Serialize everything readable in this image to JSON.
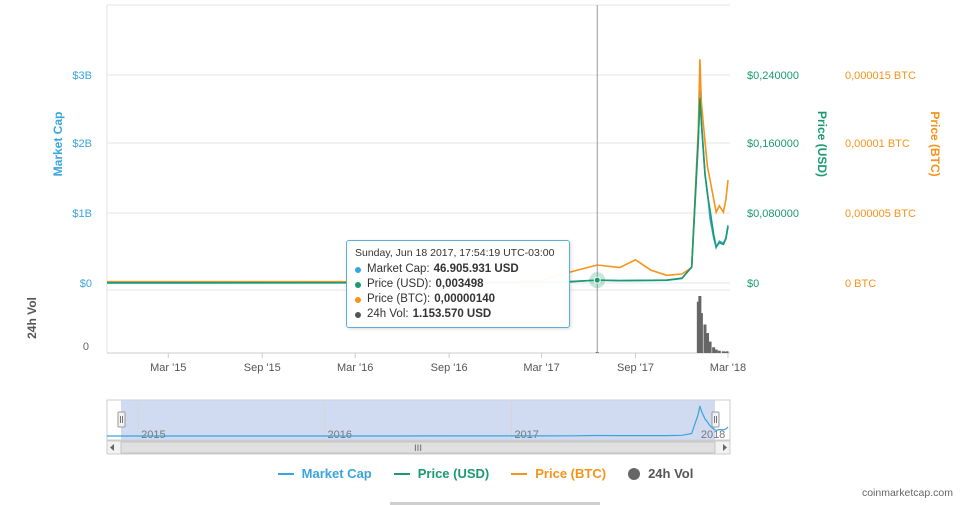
{
  "chart_data": {
    "type": "line",
    "y_axes": {
      "market_cap": {
        "title": "Market Cap",
        "ticks": [
          "$0",
          "$1B",
          "$2B",
          "$3B"
        ],
        "range": [
          0,
          3700000000
        ]
      },
      "price_usd": {
        "title": "Price (USD)",
        "ticks": [
          "$0",
          "$0,080000",
          "$0,160000",
          "$0,240000"
        ],
        "range": [
          0,
          0.296
        ]
      },
      "price_btc": {
        "title": "Price (BTC)",
        "ticks": [
          "0 BTC",
          "0,000005 BTC",
          "0,00001 BTC",
          "0,000015 BTC"
        ],
        "range": [
          0,
          1.85e-05
        ]
      },
      "volume": {
        "title": "24h Vol",
        "ticks": [
          "0"
        ]
      }
    },
    "x_ticks": [
      "Mar '15",
      "Sep '15",
      "Mar '16",
      "Sep '16",
      "Mar '17",
      "Sep '17",
      "Mar '18"
    ],
    "navigator_ticks": [
      "2015",
      "2016",
      "2017",
      "2018"
    ],
    "x": [
      "2014-11",
      "2015-03",
      "2015-09",
      "2016-03",
      "2016-09",
      "2017-01",
      "2017-03",
      "2017-05",
      "2017-06-18",
      "2017-08",
      "2017-09",
      "2017-10",
      "2017-11",
      "2017-12",
      "2017-12-20",
      "2018-01-02",
      "2018-01-05",
      "2018-01-08",
      "2018-01-15",
      "2018-01-20",
      "2018-01-25",
      "2018-02-01",
      "2018-02-06",
      "2018-02-12",
      "2018-02-20",
      "2018-02-25",
      "2018-03-01"
    ],
    "series": [
      {
        "name": "Market Cap",
        "color": "#3aa5dc",
        "axis": "market_cap",
        "values": [
          2000000,
          2000000,
          3000000,
          4000000,
          6000000,
          8000000,
          12000000,
          20000000,
          46905931,
          35000000,
          38000000,
          40000000,
          42000000,
          70000000,
          250000000,
          2200000000,
          3000000000,
          2500000000,
          1700000000,
          1400000000,
          1000000000,
          700000000,
          550000000,
          650000000,
          620000000,
          700000000,
          900000000
        ]
      },
      {
        "name": "Price (USD)",
        "color": "#1a9a70",
        "axis": "price_usd",
        "values": [
          0.0002,
          0.0002,
          0.0002,
          0.0003,
          0.0003,
          0.0004,
          0.0006,
          0.002,
          0.003498,
          0.003,
          0.0032,
          0.0034,
          0.0036,
          0.006,
          0.02,
          0.18,
          0.23,
          0.2,
          0.135,
          0.11,
          0.09,
          0.06,
          0.045,
          0.05,
          0.048,
          0.055,
          0.07
        ]
      },
      {
        "name": "Price (BTC)",
        "color": "#f7931a",
        "axis": "price_btc",
        "values": [
          1e-07,
          1e-07,
          1e-07,
          1e-07,
          1e-07,
          1e-07,
          2e-07,
          9e-07,
          1.4e-06,
          1.2e-06,
          1.8e-06,
          1e-06,
          6e-07,
          7e-07,
          1.2e-06,
          1.2e-05,
          1.74e-05,
          1.4e-05,
          1.1e-05,
          9e-06,
          8e-06,
          6.5e-06,
          5.5e-06,
          6e-06,
          5.5e-06,
          6.5e-06,
          8e-06
        ]
      },
      {
        "name": "24h Vol",
        "color": "#555555",
        "axis": "volume",
        "values": [
          0,
          0,
          0,
          0,
          0,
          0,
          0,
          0,
          1153570,
          0,
          0,
          0,
          0,
          0,
          0,
          90000000,
          100000000,
          70000000,
          50000000,
          35000000,
          20000000,
          10000000,
          6000000,
          4000000,
          3000000,
          2000000,
          3000000
        ]
      }
    ],
    "grid": true,
    "legend": "bottom"
  },
  "tooltip": {
    "date": "Sunday, Jun 18 2017, 17:54:19 UTC-03:00",
    "rows": [
      {
        "label": "Market Cap:",
        "value": "46.905.931 USD",
        "color": "#3aa5dc"
      },
      {
        "label": "Price (USD):",
        "value": "0,003498",
        "color": "#1a9a70"
      },
      {
        "label": "Price (BTC):",
        "value": "0,00000140",
        "color": "#f7931a"
      },
      {
        "label": "24h Vol:",
        "value": "1.153.570 USD",
        "color": "#555555"
      }
    ]
  },
  "legend_items": [
    {
      "label": "Market Cap",
      "color": "#3aa5dc",
      "kind": "line"
    },
    {
      "label": "Price (USD)",
      "color": "#1a9a70",
      "kind": "line"
    },
    {
      "label": "Price (BTC)",
      "color": "#f7931a",
      "kind": "line"
    },
    {
      "label": "24h Vol",
      "color": "#666666",
      "kind": "dot"
    }
  ],
  "credit": "coinmarketcap.com",
  "navigator": {
    "scrollbar_grip": "III"
  }
}
